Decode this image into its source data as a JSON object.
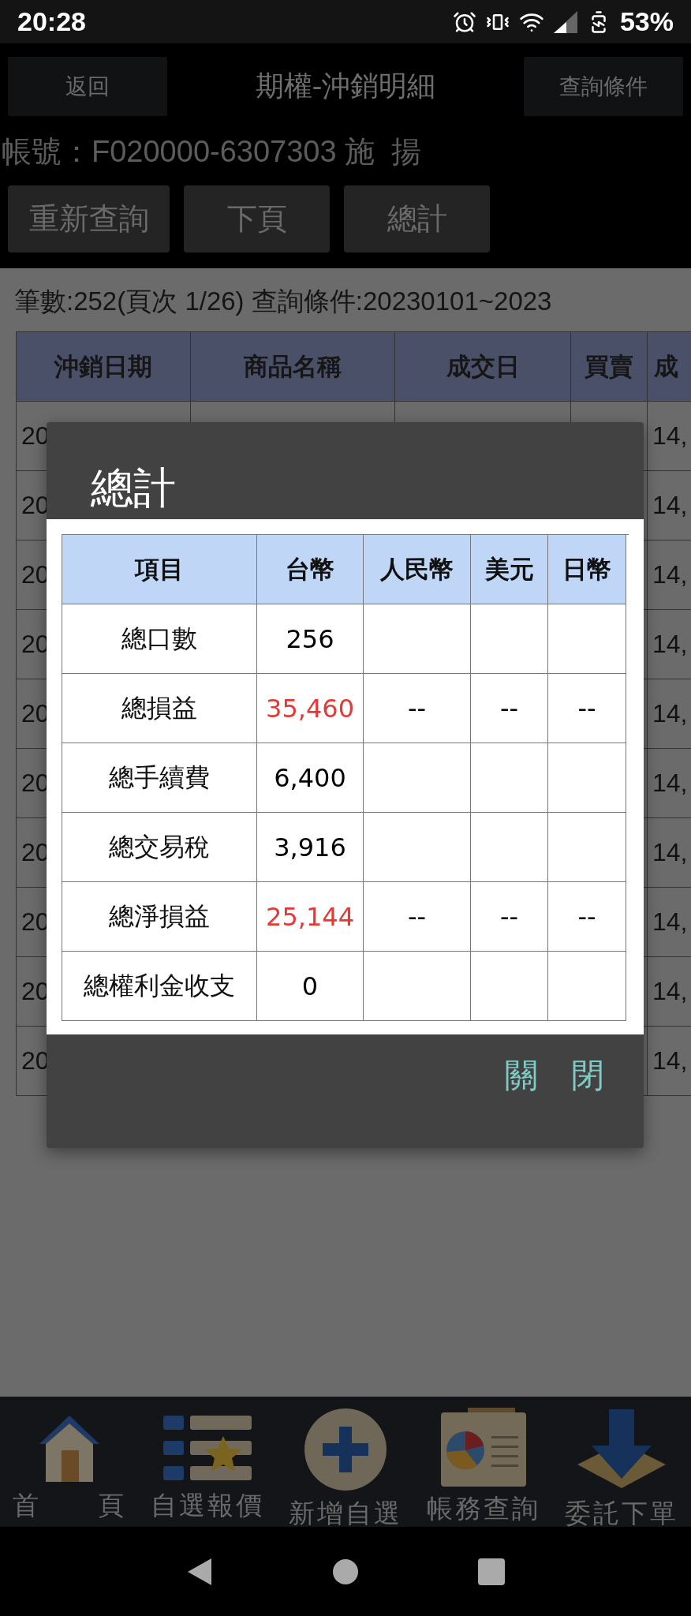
{
  "status_bar": {
    "time": "20:28",
    "battery": "53%"
  },
  "header": {
    "back_button": "返回",
    "title": "期權-沖銷明細",
    "query_button": "查詢條件"
  },
  "account": "帳號：F020000-6307303 施  揚",
  "actions": [
    "重新查詢",
    "下頁",
    "總計"
  ],
  "summary_line": "筆數:252(頁次 1/26) 查詢條件:20230101~2023",
  "table": {
    "columns": [
      "沖銷日期",
      "商品名稱",
      "成交日",
      "買賣",
      "成"
    ],
    "rows": [
      {
        "first": "20",
        "last": "14,"
      },
      {
        "first": "20",
        "last": "14,"
      },
      {
        "first": "20",
        "last": "14,"
      },
      {
        "first": "20",
        "last": "14,"
      },
      {
        "first": "20",
        "last": "14,"
      },
      {
        "first": "20",
        "last": "14,"
      },
      {
        "first": "20",
        "last": "14,"
      },
      {
        "first": "20",
        "last": "14,"
      },
      {
        "first": "20",
        "last": "14,"
      },
      {
        "first": "20",
        "last": "14,"
      }
    ]
  },
  "dialog": {
    "title": "總計",
    "columns": [
      "項目",
      "台幣",
      "人民幣",
      "美元",
      "日幣"
    ],
    "rows": [
      {
        "cells": [
          {
            "text": "總口數"
          },
          {
            "text": "256",
            "color": "#000000"
          },
          {
            "text": ""
          },
          {
            "text": ""
          },
          {
            "text": ""
          }
        ]
      },
      {
        "cells": [
          {
            "text": "總損益"
          },
          {
            "text": "35,460",
            "color": "#e53935"
          },
          {
            "text": "--",
            "color": "#000000"
          },
          {
            "text": "--",
            "color": "#000000"
          },
          {
            "text": "--",
            "color": "#000000"
          }
        ]
      },
      {
        "cells": [
          {
            "text": "總手續費"
          },
          {
            "text": "6,400",
            "color": "#000000"
          },
          {
            "text": ""
          },
          {
            "text": ""
          },
          {
            "text": ""
          }
        ]
      },
      {
        "cells": [
          {
            "text": "總交易稅"
          },
          {
            "text": "3,916",
            "color": "#000000"
          },
          {
            "text": ""
          },
          {
            "text": ""
          },
          {
            "text": ""
          }
        ]
      },
      {
        "cells": [
          {
            "text": "總淨損益"
          },
          {
            "text": "25,144",
            "color": "#e53935"
          },
          {
            "text": "--",
            "color": "#000000"
          },
          {
            "text": "--",
            "color": "#000000"
          },
          {
            "text": "--",
            "color": "#000000"
          }
        ]
      },
      {
        "cells": [
          {
            "text": "總權利金收支"
          },
          {
            "text": "0",
            "color": "#000000"
          },
          {
            "text": ""
          },
          {
            "text": ""
          },
          {
            "text": ""
          }
        ]
      }
    ],
    "close_button": "關　閉"
  },
  "bottom_nav": [
    {
      "kind": "home",
      "label": "首　　頁"
    },
    {
      "kind": "watchlist",
      "label": "自選報價"
    },
    {
      "kind": "add",
      "label": "新增自選"
    },
    {
      "kind": "report",
      "label": "帳務查詢"
    },
    {
      "kind": "order",
      "label": "委託下單"
    }
  ]
}
